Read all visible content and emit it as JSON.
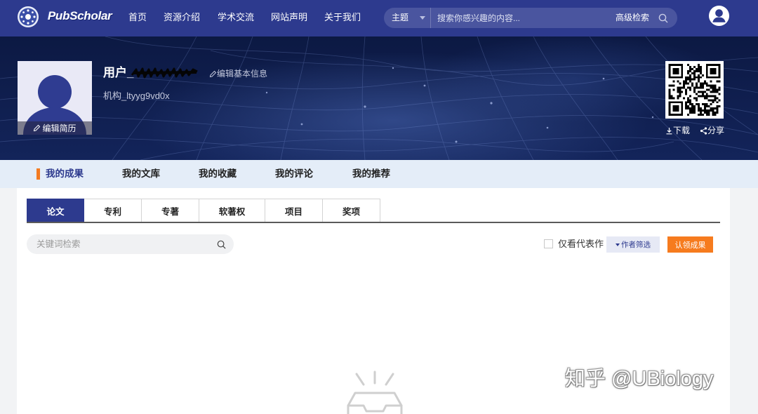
{
  "nav": {
    "logo_text": "PubScholar",
    "items": [
      "首页",
      "资源介绍",
      "学术交流",
      "网站声明",
      "关于我们"
    ],
    "search": {
      "scope": "主题",
      "placeholder": "搜索你感兴趣的内容...",
      "advanced": "高级检索"
    }
  },
  "profile": {
    "name_prefix": "用户_",
    "edit_info": "编辑基本信息",
    "institution": "机构_ltyyg9vd0x",
    "edit_resume": "编辑简历",
    "download": "下载",
    "share": "分享"
  },
  "tabs": [
    {
      "label": "我的成果",
      "active": true
    },
    {
      "label": "我的文库",
      "active": false
    },
    {
      "label": "我的收藏",
      "active": false
    },
    {
      "label": "我的评论",
      "active": false
    },
    {
      "label": "我的推荐",
      "active": false
    }
  ],
  "subtabs": [
    {
      "label": "论文",
      "active": true
    },
    {
      "label": "专利",
      "active": false
    },
    {
      "label": "专著",
      "active": false
    },
    {
      "label": "软著权",
      "active": false
    },
    {
      "label": "项目",
      "active": false
    },
    {
      "label": "奖项",
      "active": false
    }
  ],
  "filters": {
    "keyword_placeholder": "关键词检索",
    "representative_only": "仅看代表作",
    "representative_only_checked": false,
    "author_filter": "作者筛选",
    "claim": "认领成果"
  },
  "watermark": "知乎 @UBiology",
  "colors": {
    "nav_bg": "#2d3a8e",
    "accent_orange": "#f37b22",
    "tab_bar_bg": "#e4edf8",
    "claim_button_bg": "#f67b1e",
    "author_button_bg": "#e6e9f5",
    "banner_bg": "#0c1943"
  },
  "icons": [
    "logo-emblem-icon",
    "search-icon",
    "user-avatar-icon",
    "pencil-icon",
    "qr-code",
    "download-icon",
    "share-icon",
    "empty-tray-icon"
  ]
}
